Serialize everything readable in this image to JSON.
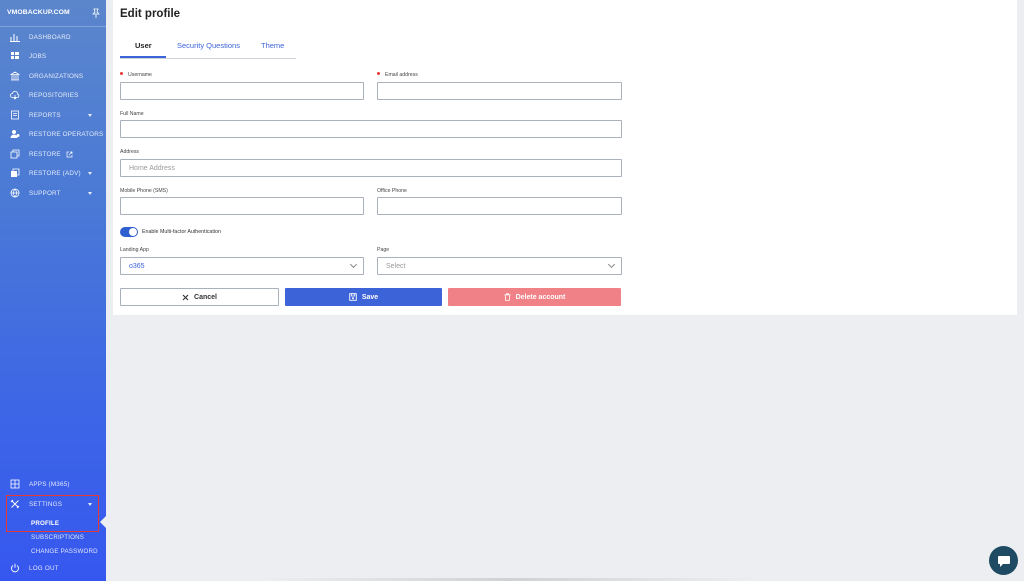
{
  "sidebar": {
    "brand": "VMOBACKUP.COM",
    "items": [
      {
        "label": "DASHBOARD",
        "icon": "bar-chart-icon"
      },
      {
        "label": "JOBS",
        "icon": "jobs-icon"
      },
      {
        "label": "ORGANIZATIONS",
        "icon": "building-icon"
      },
      {
        "label": "REPOSITORIES",
        "icon": "cloud-icon"
      },
      {
        "label": "REPORTS",
        "icon": "report-icon"
      },
      {
        "label": "RESTORE OPERATORS",
        "icon": "users-icon"
      },
      {
        "label": "RESTORE",
        "icon": "restore-icon"
      },
      {
        "label": "RESTORE (ADV)",
        "icon": "restore-adv-icon"
      },
      {
        "label": "SUPPORT",
        "icon": "globe-icon"
      }
    ],
    "bottom": {
      "apps": "APPS (M365)",
      "settings": "SETTINGS",
      "sub": [
        "PROFILE",
        "SUBSCRIPTIONS",
        "CHANGE PASSWORD"
      ],
      "logout": "LOG OUT"
    }
  },
  "main": {
    "title": "Edit profile",
    "tabs": [
      "User",
      "Security Questions",
      "Theme"
    ],
    "form": {
      "username_label": "Username",
      "email_label": "Email address",
      "fullname_label": "Full Name",
      "address_label": "Address",
      "address_placeholder": "Home Address",
      "mobile_label": "Mobile Phone (SMS)",
      "office_label": "Office Phone",
      "mfa_label": "Enable Multi-factor Authentication",
      "landing_label": "Landing App",
      "landing_value": "o365",
      "page_label": "Page",
      "page_placeholder": "Select"
    },
    "buttons": {
      "cancel": "Cancel",
      "save": "Save",
      "delete": "Delete account"
    }
  },
  "colors": {
    "accent": "#3d63d8",
    "delete": "#f08186",
    "required": "#e53935",
    "highlight_box": "#e53935"
  }
}
